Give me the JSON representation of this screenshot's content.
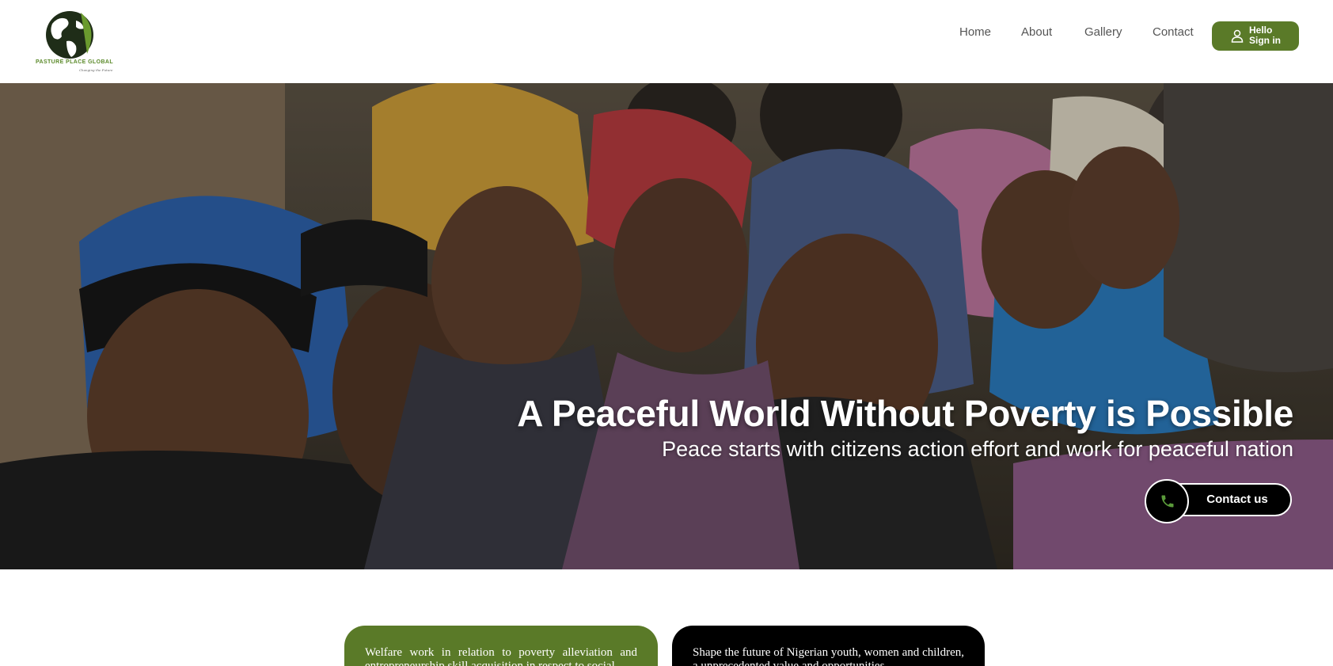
{
  "brand": {
    "name": "PASTURE PLACE GLOBAL",
    "tagline": "Changing the Future",
    "logo_icon": "globe-leaf-icon"
  },
  "nav": {
    "items": [
      {
        "label": "Home"
      },
      {
        "label": "About"
      },
      {
        "label": "Gallery"
      },
      {
        "label": "Contact"
      }
    ],
    "signin": {
      "line1": "Hello",
      "line2": "Sign in",
      "icon": "user-icon"
    }
  },
  "hero": {
    "title": "A Peaceful World Without Poverty is Possible",
    "subtitle": "Peace starts with citizens action effort and work for peaceful nation",
    "cta_label": "Contact us",
    "cta_icon": "phone-icon"
  },
  "cards": [
    {
      "text": "Welfare work in relation to poverty alleviation and entrepreneurship skill acquisition in respect to social"
    },
    {
      "text": "Shape the future of Nigerian youth, women and children, a unprecedented value and opportunities"
    }
  ],
  "colors": {
    "brand_green": "#5a7a28",
    "black": "#000000",
    "nav_text": "#555555"
  }
}
